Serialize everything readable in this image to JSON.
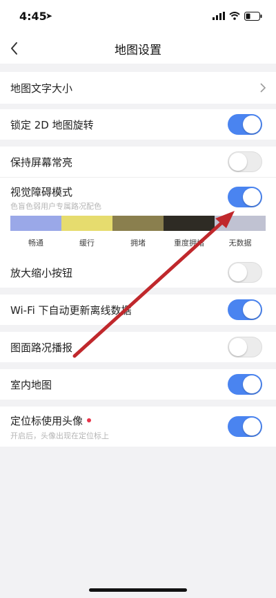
{
  "status_bar": {
    "time": "4:45"
  },
  "nav": {
    "title": "地图设置"
  },
  "rows": {
    "font_size": {
      "label": "地图文字大小"
    },
    "lock_2d": {
      "label": "锁定 2D 地图旋转",
      "on": true
    },
    "keep_screen": {
      "label": "保持屏幕常亮",
      "on": false
    },
    "visual_impair": {
      "label": "视觉障碍模式",
      "sublabel": "色盲色弱用户专属路况配色",
      "on": true,
      "legend": [
        {
          "label": "畅通",
          "color": "#9aa8e8"
        },
        {
          "label": "缓行",
          "color": "#e6dc6e"
        },
        {
          "label": "拥堵",
          "color": "#8a7f4e"
        },
        {
          "label": "重度拥堵",
          "color": "#2e2b24"
        },
        {
          "label": "无数据",
          "color": "#c0c2d2"
        }
      ]
    },
    "zoom_buttons": {
      "label": "放大缩小按钮",
      "on": false
    },
    "wifi_update": {
      "label": "Wi-Fi 下自动更新离线数据",
      "on": true
    },
    "traffic_broadcast": {
      "label": "图面路况播报",
      "on": false
    },
    "indoor_map": {
      "label": "室内地图",
      "on": true
    },
    "avatar_marker": {
      "label": "定位标使用头像",
      "sublabel": "开启后，头像出现在定位标上",
      "on": true
    }
  },
  "colors": {
    "toggle_on": "#4a84f0",
    "arrow": "#c0282c"
  }
}
